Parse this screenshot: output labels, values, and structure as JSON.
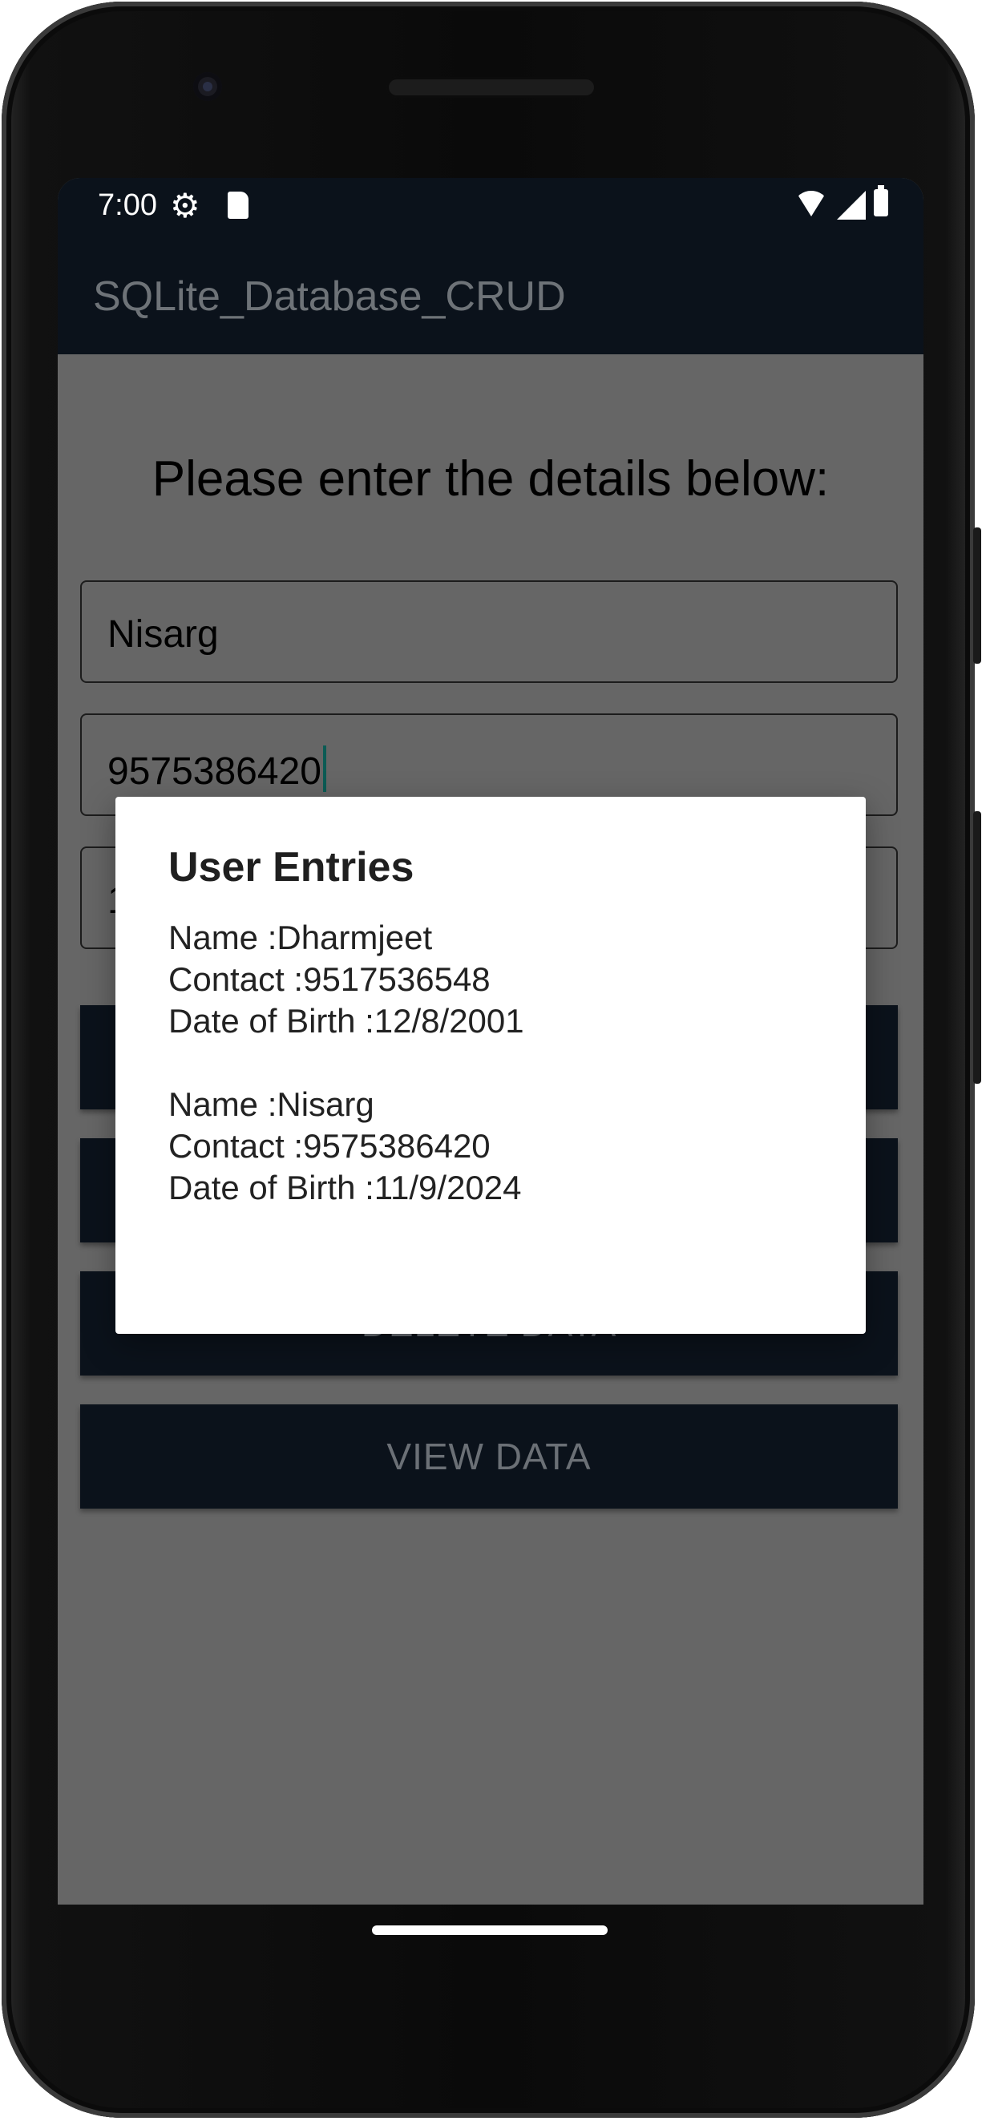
{
  "status_bar": {
    "time": "7:00",
    "icons": [
      "settings-icon",
      "sd-card-icon",
      "wifi-icon",
      "signal-icon",
      "battery-icon"
    ]
  },
  "app_bar": {
    "title": "SQLite_Database_CRUD"
  },
  "form": {
    "heading": "Please enter the details below:",
    "name_value": "Nisarg",
    "contact_value": "9575386420",
    "dob_value": "1"
  },
  "buttons": {
    "delete_label": "DELETE DATA",
    "view_label": "VIEW DATA"
  },
  "dialog": {
    "title": "User Entries",
    "entries": [
      {
        "name": "Name :Dharmjeet",
        "contact": "Contact :9517536548",
        "dob": "Date of Birth :12/8/2001"
      },
      {
        "name": "Name :Nisarg",
        "contact": "Contact :9575386420",
        "dob": "Date of Birth :11/9/2024"
      }
    ]
  },
  "colors": {
    "app_bar": "#0b121b",
    "scrim_background": "#666666",
    "dialog_background": "#ffffff",
    "button_text": "#6b7076"
  }
}
